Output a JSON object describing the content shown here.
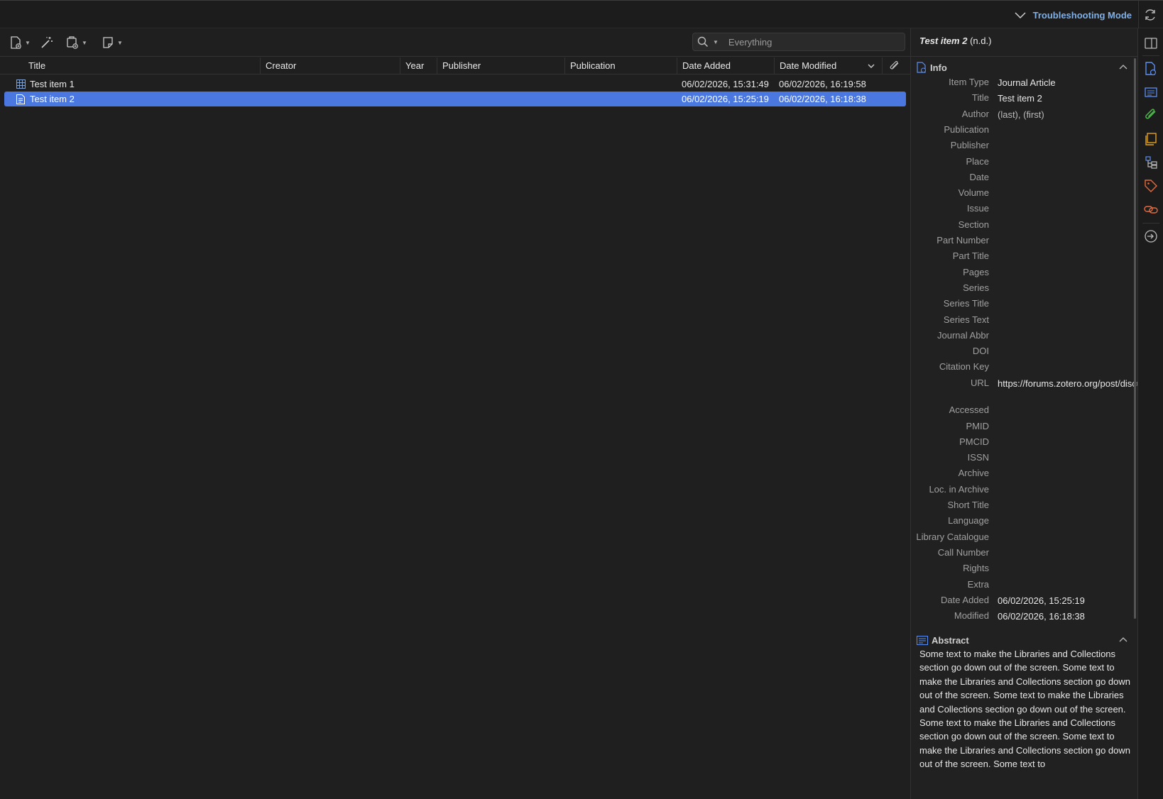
{
  "topbar": {
    "troubleshooting_label": "Troubleshooting Mode"
  },
  "search": {
    "placeholder": "Everything"
  },
  "columns": [
    "Title",
    "Creator",
    "Year",
    "Publisher",
    "Publication",
    "Date Added",
    "Date Modified"
  ],
  "items": [
    {
      "title": "Test item 1",
      "date_added": "06/02/2026, 15:31:49",
      "date_modified": "06/02/2026, 16:19:58",
      "selected": false,
      "icon": "dataset-icon"
    },
    {
      "title": "Test item 2",
      "date_added": "06/02/2026, 15:25:19",
      "date_modified": "06/02/2026, 16:18:38",
      "selected": true,
      "icon": "journal-article-icon"
    }
  ],
  "item_pane": {
    "title": "Test item 2",
    "title_suffix": "(n.d.)",
    "info_label": "Info",
    "fields": [
      {
        "label": "Item Type",
        "value": "Journal Article"
      },
      {
        "label": "Title",
        "value": "Test item 2"
      },
      {
        "label": "Author",
        "value": "(last), (first)"
      },
      {
        "label": "Publication",
        "value": ""
      },
      {
        "label": "Publisher",
        "value": ""
      },
      {
        "label": "Place",
        "value": ""
      },
      {
        "label": "Date",
        "value": ""
      },
      {
        "label": "Volume",
        "value": ""
      },
      {
        "label": "Issue",
        "value": ""
      },
      {
        "label": "Section",
        "value": ""
      },
      {
        "label": "Part Number",
        "value": ""
      },
      {
        "label": "Part Title",
        "value": ""
      },
      {
        "label": "Pages",
        "value": ""
      },
      {
        "label": "Series",
        "value": ""
      },
      {
        "label": "Series Title",
        "value": ""
      },
      {
        "label": "Series Text",
        "value": ""
      },
      {
        "label": "Journal Abbr",
        "value": ""
      },
      {
        "label": "DOI",
        "value": ""
      },
      {
        "label": "Citation Key",
        "value": ""
      },
      {
        "label": "URL",
        "value": "https://forums.zotero.org/post/discussion"
      },
      {
        "label": "Accessed",
        "value": ""
      },
      {
        "label": "PMID",
        "value": ""
      },
      {
        "label": "PMCID",
        "value": ""
      },
      {
        "label": "ISSN",
        "value": ""
      },
      {
        "label": "Archive",
        "value": ""
      },
      {
        "label": "Loc. in Archive",
        "value": ""
      },
      {
        "label": "Short Title",
        "value": ""
      },
      {
        "label": "Language",
        "value": ""
      },
      {
        "label": "Library Catalogue",
        "value": ""
      },
      {
        "label": "Call Number",
        "value": ""
      },
      {
        "label": "Rights",
        "value": ""
      },
      {
        "label": "Extra",
        "value": ""
      },
      {
        "label": "Date Added",
        "value": "06/02/2026, 15:25:19"
      },
      {
        "label": "Modified",
        "value": "06/02/2026, 16:18:38"
      }
    ],
    "abstract_label": "Abstract",
    "abstract_text": "Some text to make the Libraries and Collections section go down out of the screen. Some text to make the Libraries and Collections section go down out of the screen. Some text to make the Libraries and Collections section go down out of the screen. Some text to make the Libraries and Collections section go down out of the screen. Some text to make the Libraries and Collections section go down out of the screen. Some text to"
  },
  "colors": {
    "selection": "#4a78e0",
    "accent": "#7fb0e8"
  }
}
